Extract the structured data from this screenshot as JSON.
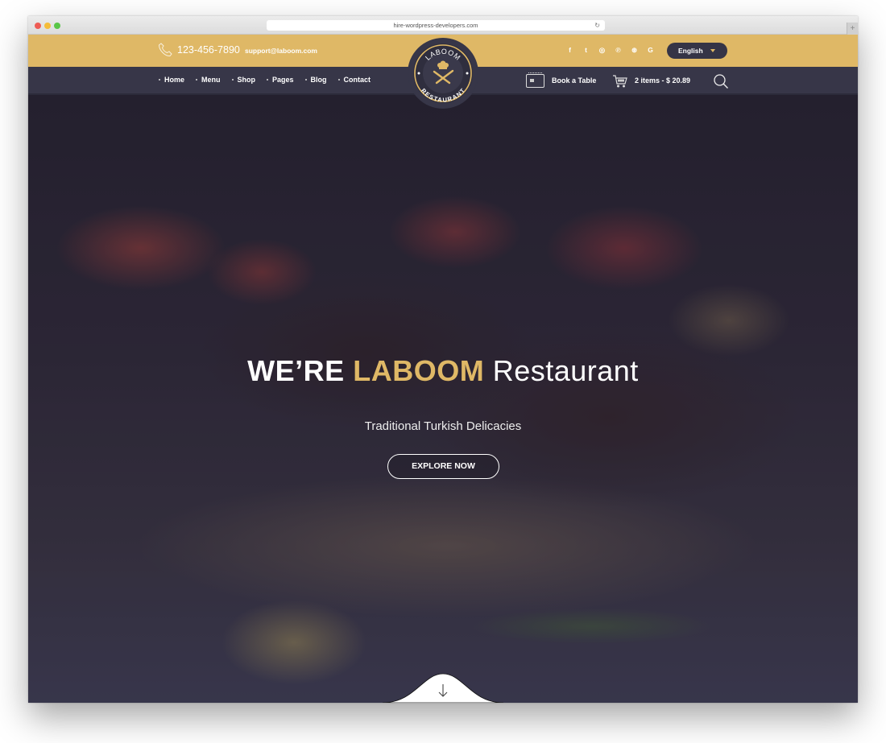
{
  "browser": {
    "url": "hire-wordpress-developers.com",
    "new_tab_label": "+"
  },
  "topbar": {
    "phone": "123-456-7890",
    "email": "support@laboom.com",
    "socials": [
      {
        "icon": "facebook-icon",
        "glyph": "f"
      },
      {
        "icon": "twitter-icon",
        "glyph": "t"
      },
      {
        "icon": "instagram-icon",
        "glyph": "◎"
      },
      {
        "icon": "pinterest-icon",
        "glyph": "℗"
      },
      {
        "icon": "dribbble-icon",
        "glyph": "⊛"
      },
      {
        "icon": "google-icon",
        "glyph": "G"
      }
    ],
    "language": "English"
  },
  "logo": {
    "top_text": "LABOOM",
    "bottom_text": "RESTAURANT"
  },
  "nav": {
    "items": [
      "Home",
      "Menu",
      "Shop",
      "Pages",
      "Blog",
      "Contact"
    ],
    "book_table": "Book a Table",
    "cart": "2 items - $ 20.89"
  },
  "hero": {
    "title_part1": "WE’RE",
    "title_part2": "LABOOM",
    "title_part3": "Restaurant",
    "subtitle": "Traditional Turkish Delicacies",
    "cta": "EXPLORE NOW"
  },
  "colors": {
    "accent": "#dfb866",
    "nav_bg": "#373648"
  }
}
